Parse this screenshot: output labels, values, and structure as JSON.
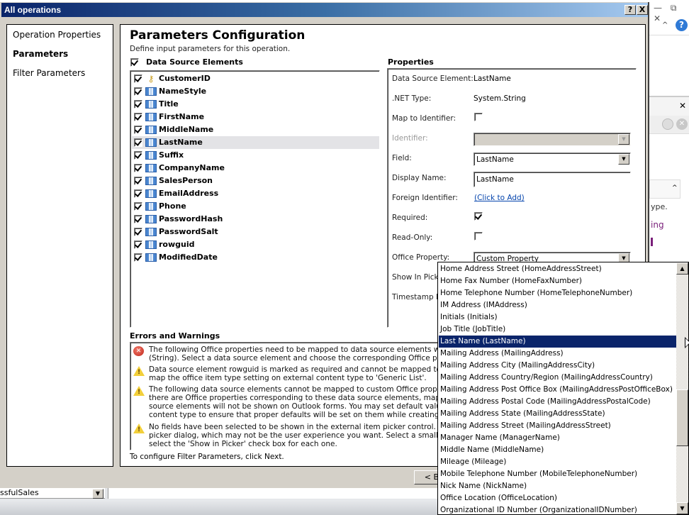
{
  "background_app": {
    "window_controls": "— ⧉ ✕",
    "help_icon_label": "?",
    "close_label": "✕",
    "partial_texts": [
      "ype.",
      "ing"
    ],
    "bottom_combo_value": "ssfulSales"
  },
  "dialog": {
    "title": "All operations",
    "help_button": "?",
    "close_button": "X"
  },
  "nav": {
    "items": [
      {
        "label": "Operation Properties",
        "active": false
      },
      {
        "label": "Parameters",
        "active": true
      },
      {
        "label": "Filter Parameters",
        "active": false
      }
    ]
  },
  "main": {
    "title": "Parameters Configuration",
    "description": "Define input parameters for this operation.",
    "data_source_header": "Data Source Elements",
    "data_source_checked": true,
    "elements": [
      {
        "name": "CustomerID",
        "icon": "key-icon",
        "checked": true,
        "selected": false
      },
      {
        "name": "NameStyle",
        "icon": "column-icon",
        "checked": true,
        "selected": false
      },
      {
        "name": "Title",
        "icon": "column-icon",
        "checked": true,
        "selected": false
      },
      {
        "name": "FirstName",
        "icon": "column-icon",
        "checked": true,
        "selected": false
      },
      {
        "name": "MiddleName",
        "icon": "column-icon",
        "checked": true,
        "selected": false
      },
      {
        "name": "LastName",
        "icon": "column-icon",
        "checked": true,
        "selected": true
      },
      {
        "name": "Suffix",
        "icon": "column-icon",
        "checked": true,
        "selected": false
      },
      {
        "name": "CompanyName",
        "icon": "column-icon",
        "checked": true,
        "selected": false
      },
      {
        "name": "SalesPerson",
        "icon": "column-icon",
        "checked": true,
        "selected": false
      },
      {
        "name": "EmailAddress",
        "icon": "column-icon",
        "checked": true,
        "selected": false
      },
      {
        "name": "Phone",
        "icon": "column-icon",
        "checked": true,
        "selected": false
      },
      {
        "name": "PasswordHash",
        "icon": "column-icon",
        "checked": true,
        "selected": false
      },
      {
        "name": "PasswordSalt",
        "icon": "column-icon",
        "checked": true,
        "selected": false
      },
      {
        "name": "rowguid",
        "icon": "column-icon",
        "checked": true,
        "selected": false
      },
      {
        "name": "ModifiedDate",
        "icon": "column-icon",
        "checked": true,
        "selected": false
      }
    ]
  },
  "properties": {
    "title": "Properties",
    "data_source_element_label": "Data Source Element:",
    "data_source_element_value": "LastName",
    "net_type_label": ".NET Type:",
    "net_type_value": "System.String",
    "map_to_identifier_label": "Map to Identifier:",
    "map_to_identifier_checked": false,
    "identifier_label": "Identifier:",
    "identifier_value": "",
    "field_label": "Field:",
    "field_value": "LastName",
    "display_name_label": "Display Name:",
    "display_name_value": "LastName",
    "foreign_identifier_label": "Foreign Identifier:",
    "foreign_identifier_link": "(Click to Add)",
    "required_label": "Required:",
    "required_checked": true,
    "read_only_label": "Read-Only:",
    "read_only_checked": false,
    "office_property_label": "Office Property:",
    "office_property_value": "Custom Property",
    "show_in_picker_label": "Show In Picker:",
    "timestamp_field_label": "Timestamp Field:"
  },
  "errors": {
    "title": "Errors and Warnings",
    "items": [
      {
        "type": "error",
        "text": "The following Office properties need to be mapped to data source elements with com\n(String). Select a data source element and choose the corresponding Office property"
      },
      {
        "type": "warning",
        "text": "Data source element rowguid is marked as required and cannot be mapped to an Offi\nmap the office item type setting on external content type to 'Generic List'."
      },
      {
        "type": "warning",
        "text": "The following data source elements cannot be mapped to custom Office properties be\nthere are Office properties corresponding to these data source elements, map them.\nsource elements will not be shown on Outlook forms. You may set default values on t\ncontent type to ensure that proper defaults will be set on them while creating new ite"
      },
      {
        "type": "warning",
        "text": "No fields have been selected to be shown in the external item picker control. By defa\npicker dialog, which may not be the user experience you want. Select a small subset\nselect the 'Show in Picker' check box for each one."
      }
    ]
  },
  "footer": {
    "hint": "To configure Filter Parameters, click Next.",
    "back_button": "< B"
  },
  "dropdown": {
    "selected": "Last Name (LastName)",
    "options": [
      "Home Address Street (HomeAddressStreet)",
      "Home Fax Number (HomeFaxNumber)",
      "Home Telephone Number (HomeTelephoneNumber)",
      "IM Address (IMAddress)",
      "Initials (Initials)",
      "Job Title (JobTitle)",
      "Last Name (LastName)",
      "Mailing Address (MailingAddress)",
      "Mailing Address City (MailingAddressCity)",
      "Mailing Address Country/Region (MailingAddressCountry)",
      "Mailing Address Post Office Box (MailingAddressPostOfficeBox)",
      "Mailing Address Postal Code (MailingAddressPostalCode)",
      "Mailing Address State (MailingAddressState)",
      "Mailing Address Street (MailingAddressStreet)",
      "Manager Name (ManagerName)",
      "Middle Name (MiddleName)",
      "Mileage (Mileage)",
      "Mobile Telephone Number (MobileTelephoneNumber)",
      "Nick Name (NickName)",
      "Office Location (OfficeLocation)",
      "Organizational ID Number (OrganizationalIDNumber)"
    ]
  }
}
